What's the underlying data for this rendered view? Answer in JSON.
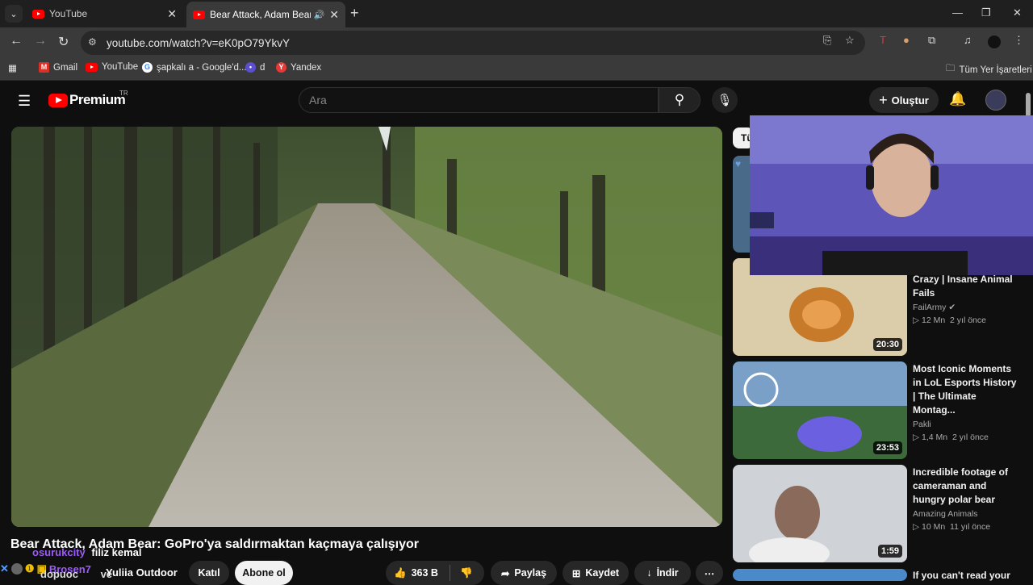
{
  "browser": {
    "tabs": [
      {
        "title": "YouTube",
        "active": false
      },
      {
        "title": "Bear Attack, Adam Bear: Go",
        "active": true
      }
    ],
    "url": "youtube.com/watch?v=eK0pO79YkvY",
    "bookmarks": [
      {
        "label": "Gmail",
        "icon": "gmail-icon"
      },
      {
        "label": "YouTube",
        "icon": "youtube-icon"
      },
      {
        "label": "şapkalı a - Google'd...",
        "icon": "google-icon"
      },
      {
        "label": "d",
        "icon": "site-icon"
      },
      {
        "label": "Yandex",
        "icon": "yandex-icon"
      }
    ],
    "all_bookmarks": "Tüm Yer İşaretleri"
  },
  "youtube": {
    "logo_text": "Premium",
    "region": "TR",
    "search_placeholder": "Ara",
    "create_label": "Oluştur"
  },
  "video": {
    "title": "Bear Attack, Adam Bear: GoPro'ya saldırmaktan kaçmaya çalışıyor",
    "channel": "Yuliia Outdoor",
    "join_label": "Katıl",
    "subscribe_label": "Abone ol",
    "likes": "363 B",
    "share_label": "Paylaş",
    "save_label": "Kaydet",
    "download_label": "İndir"
  },
  "chat_overlay": [
    {
      "user": "osurukcity",
      "message": "filiz kemal",
      "color": "#9b5cf6"
    },
    {
      "user": "dopuoc",
      "message": "ve",
      "color": "#ffffff"
    },
    {
      "user": "Brosen7",
      "message": "",
      "color": "#9b5cf6"
    }
  ],
  "filter_chip": "Tü",
  "recommendations": [
    {
      "title": "Crazy | Insane Animal Fails",
      "channel": "FailArmy",
      "verified": true,
      "views": "12 Mn",
      "age": "2 yıl önce",
      "duration": "20:30"
    },
    {
      "title": "Most Iconic Moments in LoL Esports History | The Ultimate Montag...",
      "channel": "Pakli",
      "verified": false,
      "views": "1,4 Mn",
      "age": "2 yıl önce",
      "duration": "23:53"
    },
    {
      "title": "Incredible footage of cameraman and hungry polar bear",
      "channel": "Amazing Animals",
      "verified": false,
      "views": "10 Mn",
      "age": "11 yıl önce",
      "duration": "1:59"
    },
    {
      "title": "If you can't read your",
      "channel": "",
      "verified": false,
      "views": "",
      "age": "",
      "duration": ""
    }
  ]
}
